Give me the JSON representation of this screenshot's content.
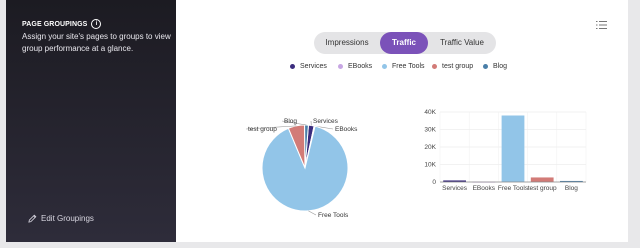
{
  "sidebar": {
    "title": "PAGE GROUPINGS",
    "info_icon": "i",
    "description": "Assign your site's pages to groups to view group performance at a glance.",
    "edit_label": "Edit Groupings"
  },
  "tabs": [
    {
      "label": "Impressions",
      "active": false
    },
    {
      "label": "Traffic",
      "active": true
    },
    {
      "label": "Traffic Value",
      "active": false
    }
  ],
  "legend": [
    {
      "label": "Services",
      "color": "#3b2d7e"
    },
    {
      "label": "EBooks",
      "color": "#c7a6e3"
    },
    {
      "label": "Free Tools",
      "color": "#92c5e8"
    },
    {
      "label": "test group",
      "color": "#d27b77"
    },
    {
      "label": "Blog",
      "color": "#4a7fa8"
    }
  ],
  "colors": {
    "accent": "#7b52b9"
  },
  "chart_data": [
    {
      "type": "pie",
      "labels": [
        "Services",
        "EBooks",
        "Free Tools",
        "test group",
        "Blog"
      ],
      "values": [
        900,
        150,
        38000,
        2600,
        600
      ],
      "colors": [
        "#3b2d7e",
        "#c7a6e3",
        "#92c5e8",
        "#d27b77",
        "#4a7fa8"
      ]
    },
    {
      "type": "bar",
      "categories": [
        "Services",
        "EBooks",
        "Free Tools",
        "test group",
        "Blog"
      ],
      "values": [
        900,
        150,
        38000,
        2600,
        600
      ],
      "colors": [
        "#3b2d7e",
        "#c7a6e3",
        "#92c5e8",
        "#d27b77",
        "#4a7fa8"
      ],
      "yticks": [
        "0",
        "10K",
        "20K",
        "30K",
        "40K"
      ],
      "ylim": [
        0,
        40000
      ],
      "grid": true
    }
  ]
}
